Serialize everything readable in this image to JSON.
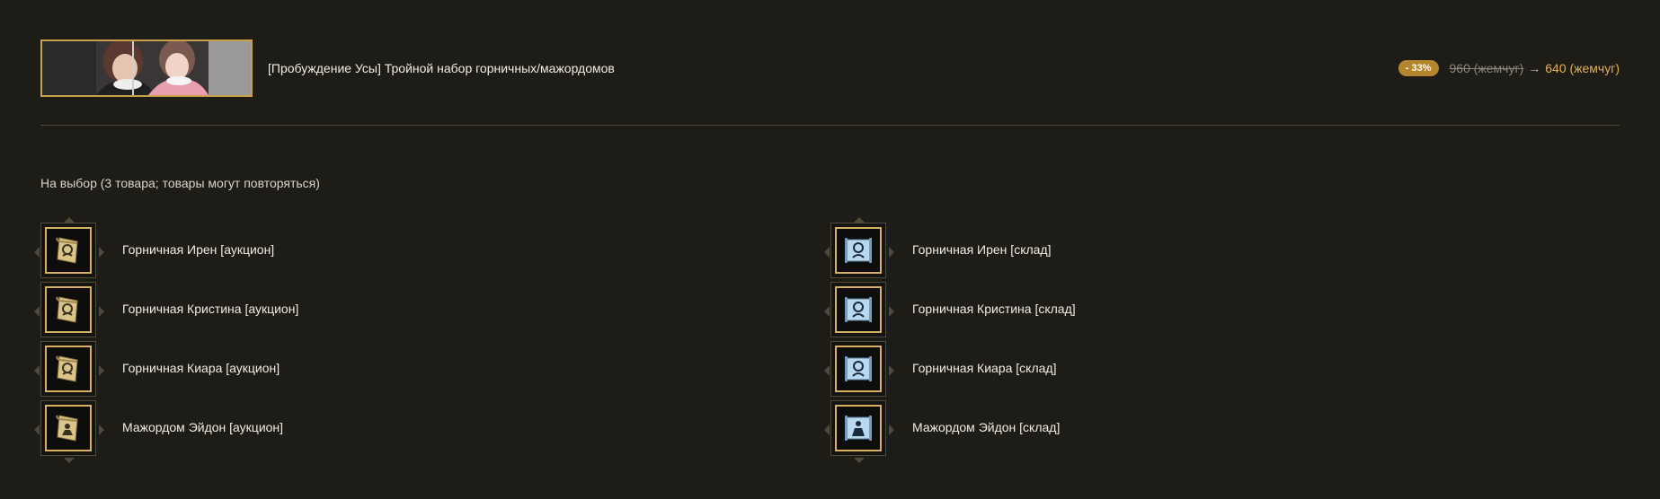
{
  "header": {
    "title": "[Пробуждение Усы] Тройной набор горничных/мажордомов",
    "discount": "- 33%",
    "old_price": "960 (жемчуг)",
    "arrow": "→",
    "new_price": "640 (жемчуг)"
  },
  "choice_label": "На выбор (3 товара; товары могут повторяться)",
  "left_items": [
    {
      "label": "Горничная Ирен [аукцион]",
      "icon": "maid-scroll-tan-icon"
    },
    {
      "label": "Горничная Кристина [аукцион]",
      "icon": "maid-scroll-tan-icon"
    },
    {
      "label": "Горничная Киара [аукцион]",
      "icon": "maid-scroll-tan-icon"
    },
    {
      "label": "Мажордом Эйдон [аукцион]",
      "icon": "butler-scroll-tan-icon"
    }
  ],
  "right_items": [
    {
      "label": "Горничная Ирен [склад]",
      "icon": "maid-scroll-blue-icon"
    },
    {
      "label": "Горничная Кристина [склад]",
      "icon": "maid-scroll-blue-icon"
    },
    {
      "label": "Горничная Киара [склад]",
      "icon": "maid-scroll-blue-icon"
    },
    {
      "label": "Мажордом Эйдон [склад]",
      "icon": "butler-scroll-blue-icon"
    }
  ],
  "colors": {
    "background": "#1d1c16",
    "accent_gold": "#c9a04a",
    "badge": "#b3862e",
    "new_price": "#e3b24d"
  }
}
